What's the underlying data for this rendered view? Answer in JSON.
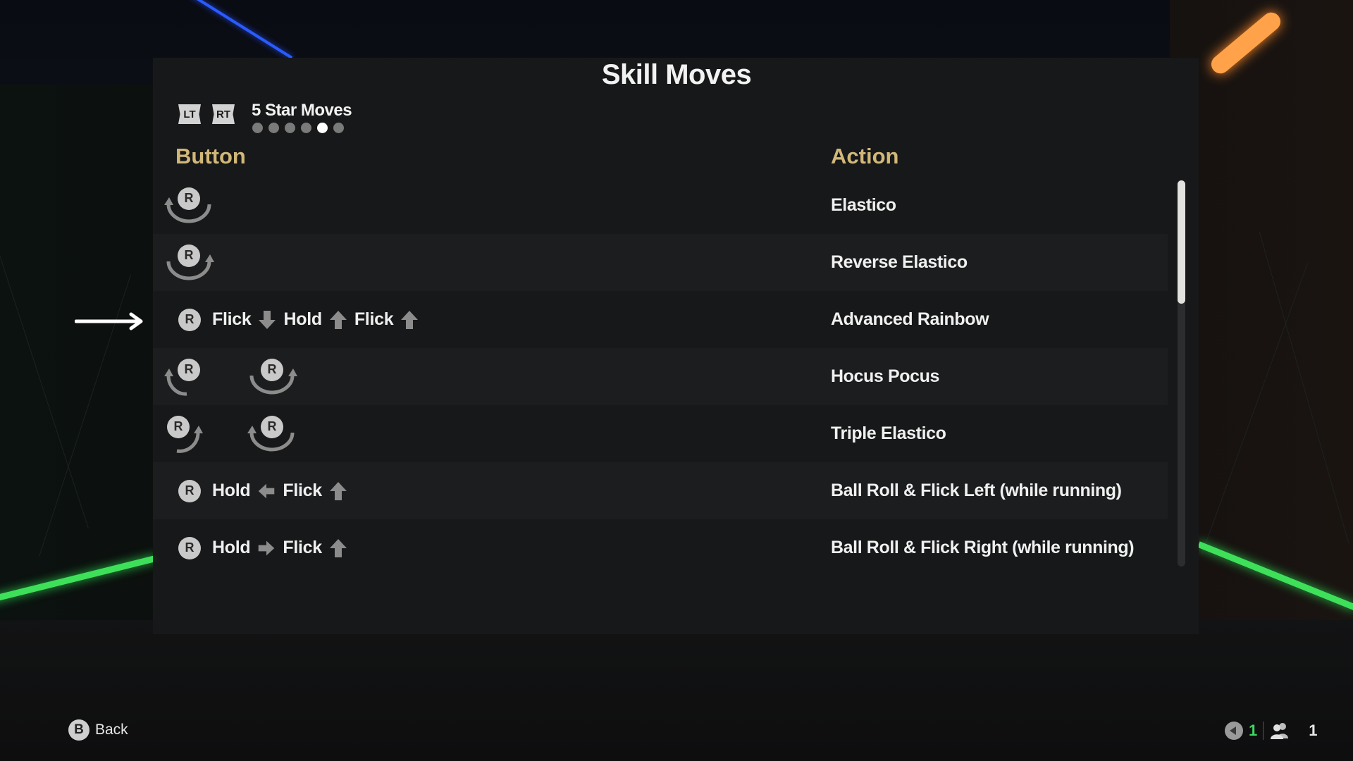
{
  "screen": {
    "title": "Skill Moves",
    "page_nav": {
      "left_trigger": "LT",
      "right_trigger": "RT",
      "page_title": "5 Star Moves",
      "page_count": 6,
      "active_page_index": 4
    },
    "columns": {
      "button": "Button",
      "action": "Action"
    },
    "colors": {
      "header_gold": "#d2b878",
      "text": "#f0f0f0",
      "badge": "#c9c9c9",
      "arrow_glyph": "#8c8c8c",
      "online_green": "#3bd760"
    },
    "rows": [
      {
        "action": "Elastico",
        "inputs": [
          {
            "type": "stick-rotate",
            "icon": "r-stick-half-circle-ccw-icon",
            "label": "R"
          }
        ]
      },
      {
        "action": "Reverse Elastico",
        "inputs": [
          {
            "type": "stick-rotate",
            "icon": "r-stick-half-circle-cw-icon",
            "label": "R"
          }
        ]
      },
      {
        "action": "Advanced Rainbow",
        "selected": true,
        "inputs": [
          {
            "type": "badge",
            "label": "R"
          },
          {
            "type": "word",
            "text": "Flick"
          },
          {
            "type": "dir",
            "dir": "down",
            "icon": "arrow-down-icon"
          },
          {
            "type": "word",
            "text": "Hold"
          },
          {
            "type": "dir",
            "dir": "up",
            "icon": "arrow-up-icon"
          },
          {
            "type": "word",
            "text": "Flick"
          },
          {
            "type": "dir",
            "dir": "up",
            "icon": "arrow-up-icon"
          }
        ]
      },
      {
        "action": "Hocus Pocus",
        "inputs": [
          {
            "type": "stick-rotate",
            "icon": "r-stick-quarter-ccw-icon",
            "label": "R"
          },
          {
            "type": "stick-rotate",
            "icon": "r-stick-half-circle-cw-icon",
            "label": "R"
          }
        ]
      },
      {
        "action": "Triple Elastico",
        "inputs": [
          {
            "type": "stick-rotate",
            "icon": "r-stick-quarter-cw-icon",
            "label": "R"
          },
          {
            "type": "stick-rotate",
            "icon": "r-stick-half-circle-ccw-icon",
            "label": "R"
          }
        ]
      },
      {
        "action": "Ball Roll & Flick Left (while running)",
        "inputs": [
          {
            "type": "badge",
            "label": "R"
          },
          {
            "type": "word",
            "text": "Hold"
          },
          {
            "type": "dir",
            "dir": "left",
            "icon": "arrow-left-icon"
          },
          {
            "type": "word",
            "text": "Flick"
          },
          {
            "type": "dir",
            "dir": "up",
            "icon": "arrow-up-icon"
          }
        ]
      },
      {
        "action": "Ball Roll & Flick Right (while running)",
        "inputs": [
          {
            "type": "badge",
            "label": "R"
          },
          {
            "type": "word",
            "text": "Hold"
          },
          {
            "type": "dir",
            "dir": "right",
            "icon": "arrow-right-icon"
          },
          {
            "type": "word",
            "text": "Flick"
          },
          {
            "type": "dir",
            "dir": "up",
            "icon": "arrow-up-icon"
          }
        ]
      }
    ],
    "scroll": {
      "thumb_fraction": 0.32,
      "position_fraction": 0.0
    }
  },
  "footer": {
    "back": {
      "button": "B",
      "label": "Back"
    },
    "status": {
      "voice_count": "1",
      "party_count": "1"
    }
  }
}
